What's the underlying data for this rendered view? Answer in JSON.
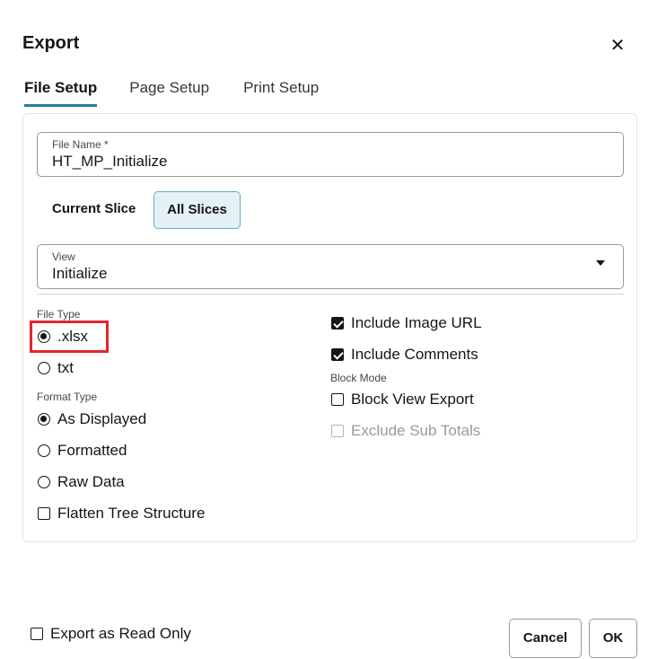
{
  "dialog": {
    "title": "Export",
    "close_glyph": "✕"
  },
  "tabs": [
    {
      "label": "File Setup",
      "active": true
    },
    {
      "label": "Page Setup",
      "active": false
    },
    {
      "label": "Print Setup",
      "active": false
    }
  ],
  "file_name": {
    "label": "File Name *",
    "value": "HT_MP_Initialize"
  },
  "slice": {
    "current_label": "Current Slice",
    "all_label": "All Slices",
    "selected": "All Slices"
  },
  "view": {
    "label": "View",
    "value": "Initialize"
  },
  "file_type": {
    "label": "File Type",
    "options": [
      {
        "label": ".xlsx",
        "checked": true
      },
      {
        "label": "txt",
        "checked": false
      }
    ]
  },
  "format_type": {
    "label": "Format Type",
    "options": [
      {
        "label": "As Displayed",
        "checked": true
      },
      {
        "label": "Formatted",
        "checked": false
      },
      {
        "label": "Raw Data",
        "checked": false
      }
    ]
  },
  "flatten_tree": {
    "label": "Flatten Tree Structure",
    "checked": false
  },
  "include_image_url": {
    "label": "Include Image URL",
    "checked": true
  },
  "include_comments": {
    "label": "Include Comments",
    "checked": true
  },
  "block_mode": {
    "label": "Block Mode",
    "block_view_export": {
      "label": "Block View Export",
      "checked": false
    },
    "exclude_sub_totals": {
      "label": "Exclude Sub Totals",
      "checked": false,
      "disabled": true
    }
  },
  "footer": {
    "read_only": {
      "label": "Export as Read Only",
      "checked": false
    },
    "cancel_label": "Cancel",
    "ok_label": "OK"
  },
  "colors": {
    "accent": "#227e9e",
    "highlight": "#e0262e",
    "selected_bg": "#e4f1f7"
  }
}
